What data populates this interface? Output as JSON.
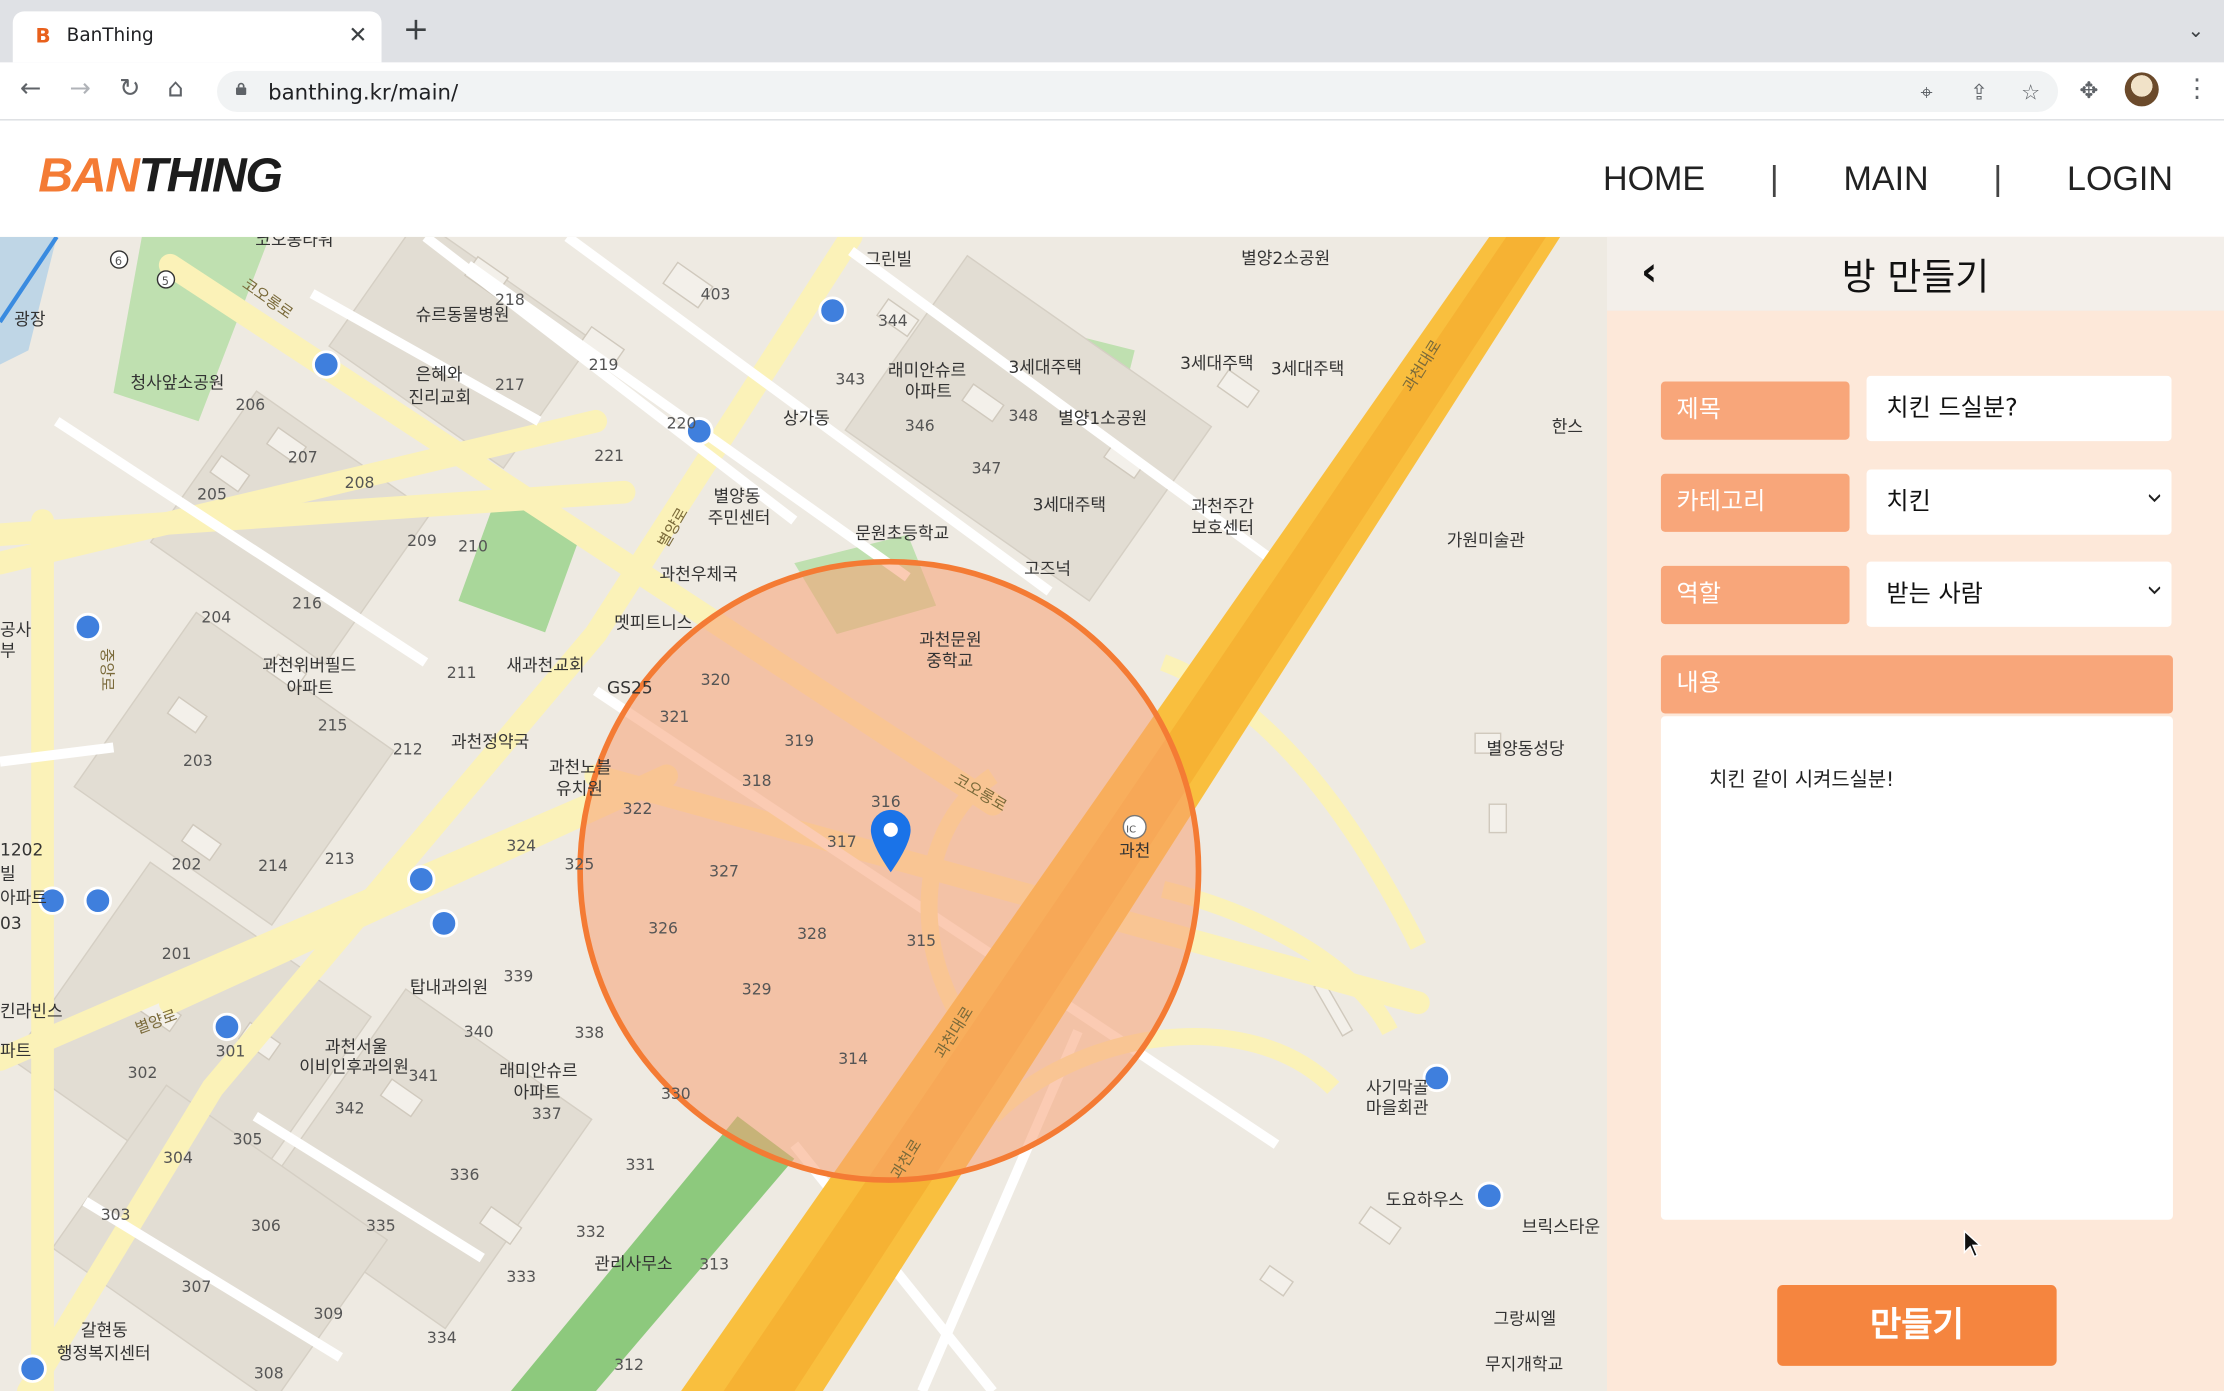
{
  "browser": {
    "tab_title": "BanThing",
    "favicon_letter": "B",
    "url": "banthing.kr/main/"
  },
  "header": {
    "logo_part1": "BAN",
    "logo_part2": "THING",
    "nav": [
      "HOME",
      "MAIN",
      "LOGIN"
    ],
    "nav_separator": "|"
  },
  "map": {
    "accent_color": "#f47b34",
    "circle_fill": "#f7a075",
    "labels": {
      "ssyureu": "슈르동물병원",
      "cheongsa": "청사앞소공원",
      "eunhye1": "은혜와",
      "eunhye2": "진리교회",
      "gwangjang": "광장",
      "kong1": "공사",
      "kong2": "부",
      "greenvill": "그린빌",
      "sanggadong": "상가동",
      "raemian1": "래미안슈르",
      "raemian2": "아파트",
      "sede1": "3세대주택",
      "sede2": "3세대주택",
      "sede3": "3세대주택",
      "sede4": "3세대주택",
      "byeolyang1park": "별양1소공원",
      "byeolyang2park": "별양2소공원",
      "byeolyangdong1": "별양동",
      "byeolyangdong2": "주민센터",
      "munwon_elem": "문원초등학교",
      "gwacheon_post": "과천우체국",
      "gojeuneok": "고즈넉",
      "gwacheon_daycare1": "과천주간",
      "gwacheon_daycare2": "보호센터",
      "hanse": "한스",
      "gawon_museum": "가원미술관",
      "metpitness": "멧피트니스",
      "saegwacheon": "새과천교회",
      "gs25": "GS25",
      "munwon_middle1": "과천문원",
      "munwon_middle2": "중학교",
      "wibervill1": "과천위버필드",
      "wibervill2": "아파트",
      "gwacheon_pharmacy": "과천정약국",
      "kindergarten1": "과천노블",
      "kindergarten2": "유치원",
      "byeolyang_church": "별양동성당",
      "ic_name": "과천",
      "ic_badge": "IC",
      "tapnae": "탑내과의원",
      "seoul_ent1": "과천서울",
      "seoul_ent2": "이비인후과의원",
      "raemian3": "래미안슈르",
      "raemian4": "아파트",
      "kirabins": "킨라빈스",
      "apt_left": "파트",
      "sagimak1": "사기막골",
      "sagimak2": "마을회관",
      "doyo": "도요하우스",
      "brick": "브릭스타운",
      "gwanri": "관리사무소",
      "galhyeon1": "갈현동",
      "galhyeon2": "행정복지센터",
      "grangssiel": "그랑씨엘",
      "mujigae": "무지개학교",
      "top_partial": "코오롱타워",
      "road_koolong1": "코오롱로",
      "road_koolong2": "코오롱로",
      "road_byeolyang1": "별양로",
      "road_byeolyang2": "별양로",
      "road_gwacheon1": "과천대로",
      "road_gwacheon2": "과천대로",
      "road_jungang": "중앙로",
      "road_gwacheonro": "과천로",
      "edge_1202": "1202",
      "edge_bil": "빌",
      "edge_apt": "아파트",
      "edge_03": "03"
    },
    "numbers": {
      "n403": "403",
      "n218": "218",
      "n219": "219",
      "n217": "217",
      "n206": "206",
      "n207": "207",
      "n208": "208",
      "n205": "205",
      "n209": "209",
      "n210": "210",
      "n204": "204",
      "n216": "216",
      "n211": "211",
      "n215": "215",
      "n212": "212",
      "n203": "203",
      "n202": "202",
      "n214": "214",
      "n213": "213",
      "n201": "201",
      "n220": "220",
      "n221": "221",
      "n344": "344",
      "n343": "343",
      "n346": "346",
      "n348": "348",
      "n347": "347",
      "n320": "320",
      "n321": "321",
      "n319": "319",
      "n318": "318",
      "n322": "322",
      "n316": "316",
      "n317": "317",
      "n324": "324",
      "n325": "325",
      "n327": "327",
      "n326": "326",
      "n328": "328",
      "n315": "315",
      "n329": "329",
      "n314": "314",
      "n339": "339",
      "n340": "340",
      "n341": "341",
      "n338": "338",
      "n342": "342",
      "n337": "337",
      "n302": "302",
      "n301": "301",
      "n305": "305",
      "n304": "304",
      "n336": "336",
      "n330": "330",
      "n331": "331",
      "n303": "303",
      "n306": "306",
      "n335": "335",
      "n332": "332",
      "n313": "313",
      "n307": "307",
      "n333": "333",
      "n309": "309",
      "n334": "334",
      "n308": "308",
      "n312": "312",
      "n6": "6",
      "n5": "5"
    }
  },
  "panel": {
    "back_icon": "chevron-left-icon",
    "title": "방 만들기",
    "fields": {
      "title_label": "제목",
      "title_value": "치킨 드실분?",
      "category_label": "카테고리",
      "category_value": "치킨",
      "role_label": "역할",
      "role_value": "받는 사람",
      "content_label": "내용",
      "content_value": "치킨 같이 시켜드실분!"
    },
    "submit_label": "만들기",
    "colors": {
      "panel_bg": "#fde8d9",
      "label_bg": "#f8a67a",
      "button_bg": "#f5853f"
    }
  }
}
